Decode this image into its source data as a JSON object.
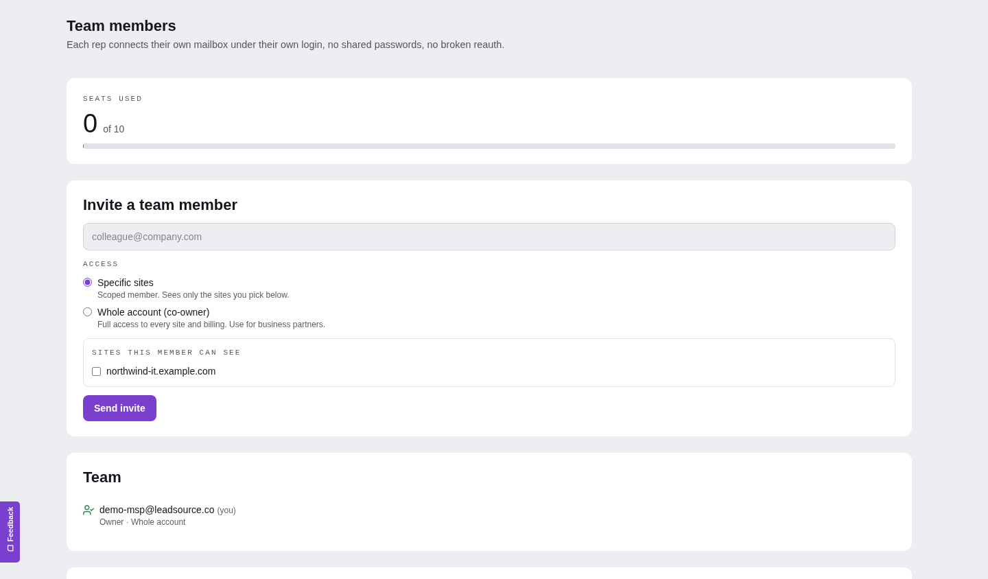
{
  "page": {
    "title": "Team members",
    "subtitle": "Each rep connects their own mailbox under their own login, no shared passwords, no broken reauth."
  },
  "seats": {
    "label": "SEATS USED",
    "used": "0",
    "total": "of 10",
    "level": 0
  },
  "invite": {
    "title": "Invite a team member",
    "email": {
      "placeholder": "colleague@company.com"
    },
    "access_label": "ACCESS",
    "access_options": [
      {
        "label": "Specific sites",
        "description": "Scoped member. Sees only the sites you pick below.",
        "selected": true
      },
      {
        "label": "Whole account (co-owner)",
        "description": "Full access to every site and billing. Use for business partners.",
        "selected": false
      }
    ],
    "sites": {
      "label": "SITES THIS MEMBER CAN SEE",
      "items": [
        {
          "label": "northwind-it.example.com",
          "checked": false
        }
      ]
    },
    "button": "Send invite"
  },
  "team": {
    "title": "Team",
    "members": [
      {
        "email": "demo-msp@leadsource.co",
        "tag": "(you)",
        "role": "Owner · Whole account"
      }
    ]
  },
  "feedback": {
    "label": "Feedback"
  }
}
